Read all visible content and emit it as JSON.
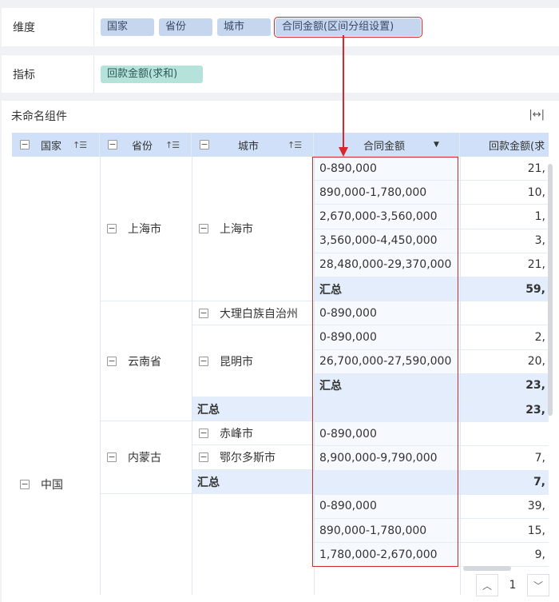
{
  "dimensions": {
    "label": "维度",
    "chips": [
      "国家",
      "省份",
      "城市",
      "合同金额(区间分组设置)"
    ]
  },
  "metrics": {
    "label": "指标",
    "chips": [
      "回款金额(求和)"
    ]
  },
  "widget": {
    "title": "未命名组件",
    "expand_icon": "expand-horizontal-icon"
  },
  "table": {
    "headers": {
      "country": "国家",
      "province": "省份",
      "city": "城市",
      "amount": "合同金额",
      "payment": "回款金额(求"
    },
    "countries": [
      {
        "name": "中国"
      }
    ],
    "provinces": [
      {
        "name": "上海市"
      },
      {
        "name": "云南省"
      },
      {
        "name": "内蒙古"
      },
      {
        "name": ""
      }
    ],
    "cities": [
      {
        "name": "上海市"
      },
      {
        "name": "大理白族自治州"
      },
      {
        "name": "昆明市"
      },
      {
        "name": "赤峰市"
      },
      {
        "name": "鄂尔多斯市"
      }
    ],
    "subtotal_label": "汇总",
    "rows": [
      {
        "amount": "0-890,000",
        "payment": "21,",
        "total": false
      },
      {
        "amount": "890,000-1,780,000",
        "payment": "10,",
        "total": false
      },
      {
        "amount": "2,670,000-3,560,000",
        "payment": "1,",
        "total": false
      },
      {
        "amount": "3,560,000-4,450,000",
        "payment": "3,",
        "total": false
      },
      {
        "amount": "28,480,000-29,370,000",
        "payment": "21,",
        "total": false
      },
      {
        "amount": "汇总",
        "payment": "59,",
        "total": true
      },
      {
        "amount": "0-890,000",
        "payment": "",
        "total": false
      },
      {
        "amount": "0-890,000",
        "payment": "2,",
        "total": false
      },
      {
        "amount": "26,700,000-27,590,000",
        "payment": "20,",
        "total": false
      },
      {
        "amount": "汇总",
        "payment": "23,",
        "total": true
      },
      {
        "amount": "",
        "payment": "23,",
        "total": true
      },
      {
        "amount": "0-890,000",
        "payment": "",
        "total": false
      },
      {
        "amount": "8,900,000-9,790,000",
        "payment": "7,",
        "total": false
      },
      {
        "amount": "",
        "payment": "7,",
        "total": true
      },
      {
        "amount": "0-890,000",
        "payment": "39,",
        "total": false
      },
      {
        "amount": "890,000-1,780,000",
        "payment": "15,",
        "total": false
      },
      {
        "amount": "1,780,000-2,670,000",
        "payment": "9,",
        "total": false
      }
    ]
  },
  "pager": {
    "page": "1",
    "up_icon": "chevron-up-icon",
    "down_icon": "chevron-down-icon"
  },
  "colors": {
    "header_bg": "#cfe0f8",
    "chip_blue": "#c7d6ef",
    "chip_teal": "#b5e3dc",
    "highlight_red": "#d9262b",
    "subtotal_bg": "#e3edfb"
  }
}
